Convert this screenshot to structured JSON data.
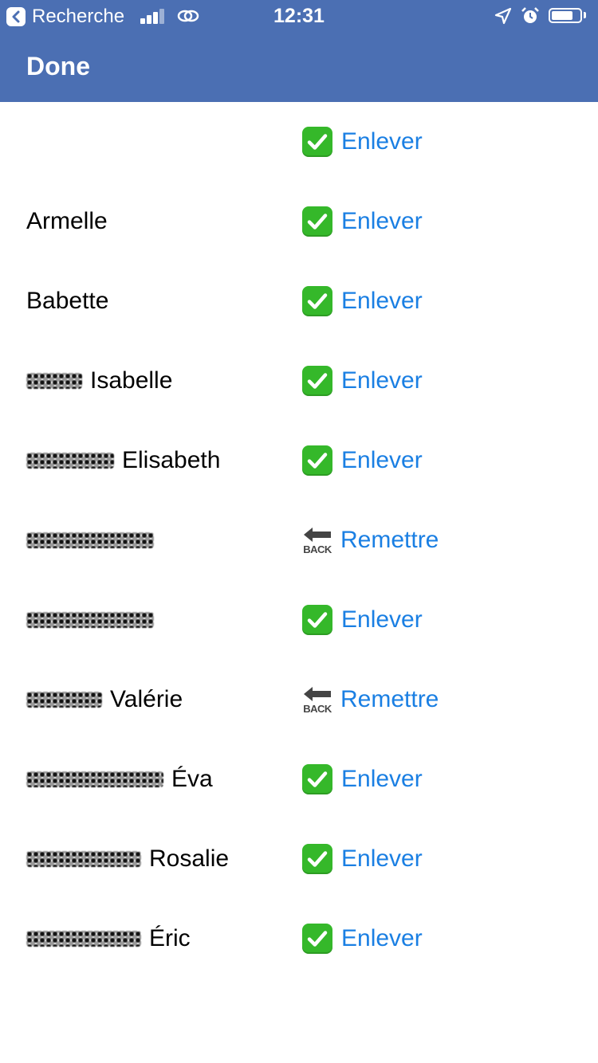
{
  "status_bar": {
    "back_app": "Recherche",
    "time": "12:31",
    "battery_level": 0.75
  },
  "navbar": {
    "done_label": "Done"
  },
  "rows": [
    {
      "name": "",
      "redacted": false,
      "action": "Enlever",
      "icon": "check-mark-icon"
    },
    {
      "name": "Armelle",
      "redacted": false,
      "action": "Enlever",
      "icon": "check-mark-icon"
    },
    {
      "name": "Babette",
      "redacted": false,
      "action": "Enlever",
      "icon": "check-mark-icon"
    },
    {
      "name": "Isabelle",
      "redacted": true,
      "action": "Enlever",
      "icon": "check-mark-icon"
    },
    {
      "name": "Elisabeth",
      "redacted": true,
      "action": "Enlever",
      "icon": "check-mark-icon"
    },
    {
      "name": "",
      "redacted": true,
      "action": "Remettre",
      "icon": "back-arrow-icon"
    },
    {
      "name": "",
      "redacted": true,
      "action": "Enlever",
      "icon": "check-mark-icon"
    },
    {
      "name": "Valérie",
      "redacted": true,
      "action": "Remettre",
      "icon": "back-arrow-icon"
    },
    {
      "name": "Éva",
      "redacted": true,
      "action": "Enlever",
      "icon": "check-mark-icon"
    },
    {
      "name": "Rosalie",
      "redacted": true,
      "action": "Enlever",
      "icon": "check-mark-icon"
    },
    {
      "name": "Éric",
      "redacted": true,
      "action": "Enlever",
      "icon": "check-mark-icon"
    }
  ],
  "back_icon_word": "BACK",
  "colors": {
    "header": "#4b6fb3",
    "link": "#1a7fe3",
    "check": "#35b82a"
  }
}
